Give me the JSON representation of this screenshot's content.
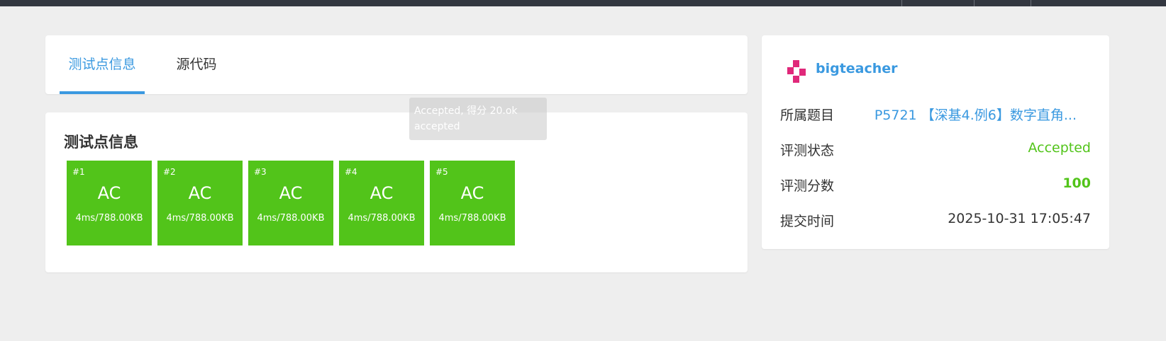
{
  "tabs": [
    {
      "label": "测试点信息",
      "active": true
    },
    {
      "label": "源代码",
      "active": false
    }
  ],
  "tests": {
    "title": "测试点信息",
    "items": [
      {
        "index": "#1",
        "result": "AC",
        "stat": "4ms/788.00KB"
      },
      {
        "index": "#2",
        "result": "AC",
        "stat": "4ms/788.00KB"
      },
      {
        "index": "#3",
        "result": "AC",
        "stat": "4ms/788.00KB"
      },
      {
        "index": "#4",
        "result": "AC",
        "stat": "4ms/788.00KB"
      },
      {
        "index": "#5",
        "result": "AC",
        "stat": "4ms/788.00KB"
      }
    ]
  },
  "tooltip": {
    "line1": "Accepted, 得分 20.ok",
    "line2": "accepted"
  },
  "info": {
    "username": "bigteacher",
    "problem_label": "所属题目",
    "problem_value": "P5721 【深基4.例6】数字直角...",
    "status_label": "评测状态",
    "status_value": "Accepted",
    "score_label": "评测分数",
    "score_value": "100",
    "time_label": "提交时间",
    "time_value": "2025-10-31 17:05:47"
  },
  "colors": {
    "accent": "#3a99e0",
    "success": "#52c41a",
    "logo": "#e0287a"
  }
}
